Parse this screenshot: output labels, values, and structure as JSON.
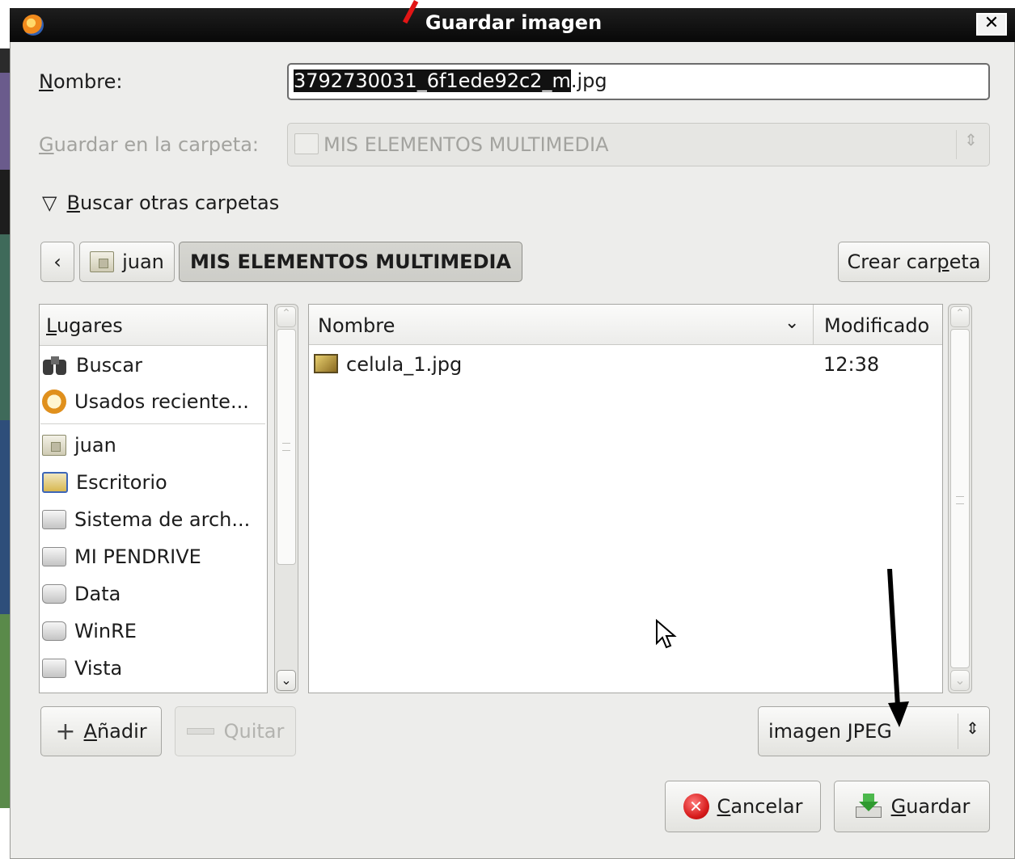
{
  "window": {
    "title": "Guardar imagen",
    "close_label": "✕"
  },
  "name_field": {
    "label_accesskey": "N",
    "label_rest": "ombre:",
    "value_selected": "3792730031_6f1ede92c2_m",
    "value_rest": ".jpg"
  },
  "save_in": {
    "label_accesskey": "G",
    "label_rest": "uardar en la carpeta:",
    "value": "MIS ELEMENTOS MULTIMEDIA"
  },
  "browse": {
    "label_accesskey": "B",
    "label_rest": "uscar otras carpetas",
    "expander": "▽"
  },
  "path_bar": {
    "back": "‹",
    "crumbs": [
      {
        "label": "juan",
        "active": false
      },
      {
        "label": "MIS ELEMENTOS MULTIMEDIA",
        "active": true
      }
    ],
    "create_folder_pre": "Crear car",
    "create_folder_key": "p",
    "create_folder_post": "eta"
  },
  "places": {
    "header_accesskey": "L",
    "header_rest": "ugares",
    "items": [
      {
        "label": "Buscar",
        "icon": "binoculars-icon"
      },
      {
        "label": "Usados reciente...",
        "icon": "recent-icon"
      },
      {
        "label": "juan",
        "icon": "home-folder-icon"
      },
      {
        "label": "Escritorio",
        "icon": "desktop-icon"
      },
      {
        "label": "Sistema de arch...",
        "icon": "filesystem-icon"
      },
      {
        "label": "MI PENDRIVE",
        "icon": "drive-icon"
      },
      {
        "label": "Data",
        "icon": "drive-icon"
      },
      {
        "label": "WinRE",
        "icon": "drive-icon"
      },
      {
        "label": "Vista",
        "icon": "drive-icon"
      }
    ],
    "add_accesskey": "A",
    "add_rest": "ñadir",
    "remove_label": "Quitar"
  },
  "files": {
    "col_name": "Nombre",
    "col_modified": "Modificado",
    "rows": [
      {
        "name": "celula_1.jpg",
        "modified": "12:38"
      }
    ]
  },
  "filter": {
    "value": "imagen JPEG"
  },
  "actions": {
    "cancel_accesskey": "C",
    "cancel_rest": "ancelar",
    "save_accesskey": "G",
    "save_rest": "uardar"
  },
  "colors": {
    "titlebar": "#0f0f0f",
    "cancel_red": "#d82020",
    "save_green": "#3aa53a"
  }
}
